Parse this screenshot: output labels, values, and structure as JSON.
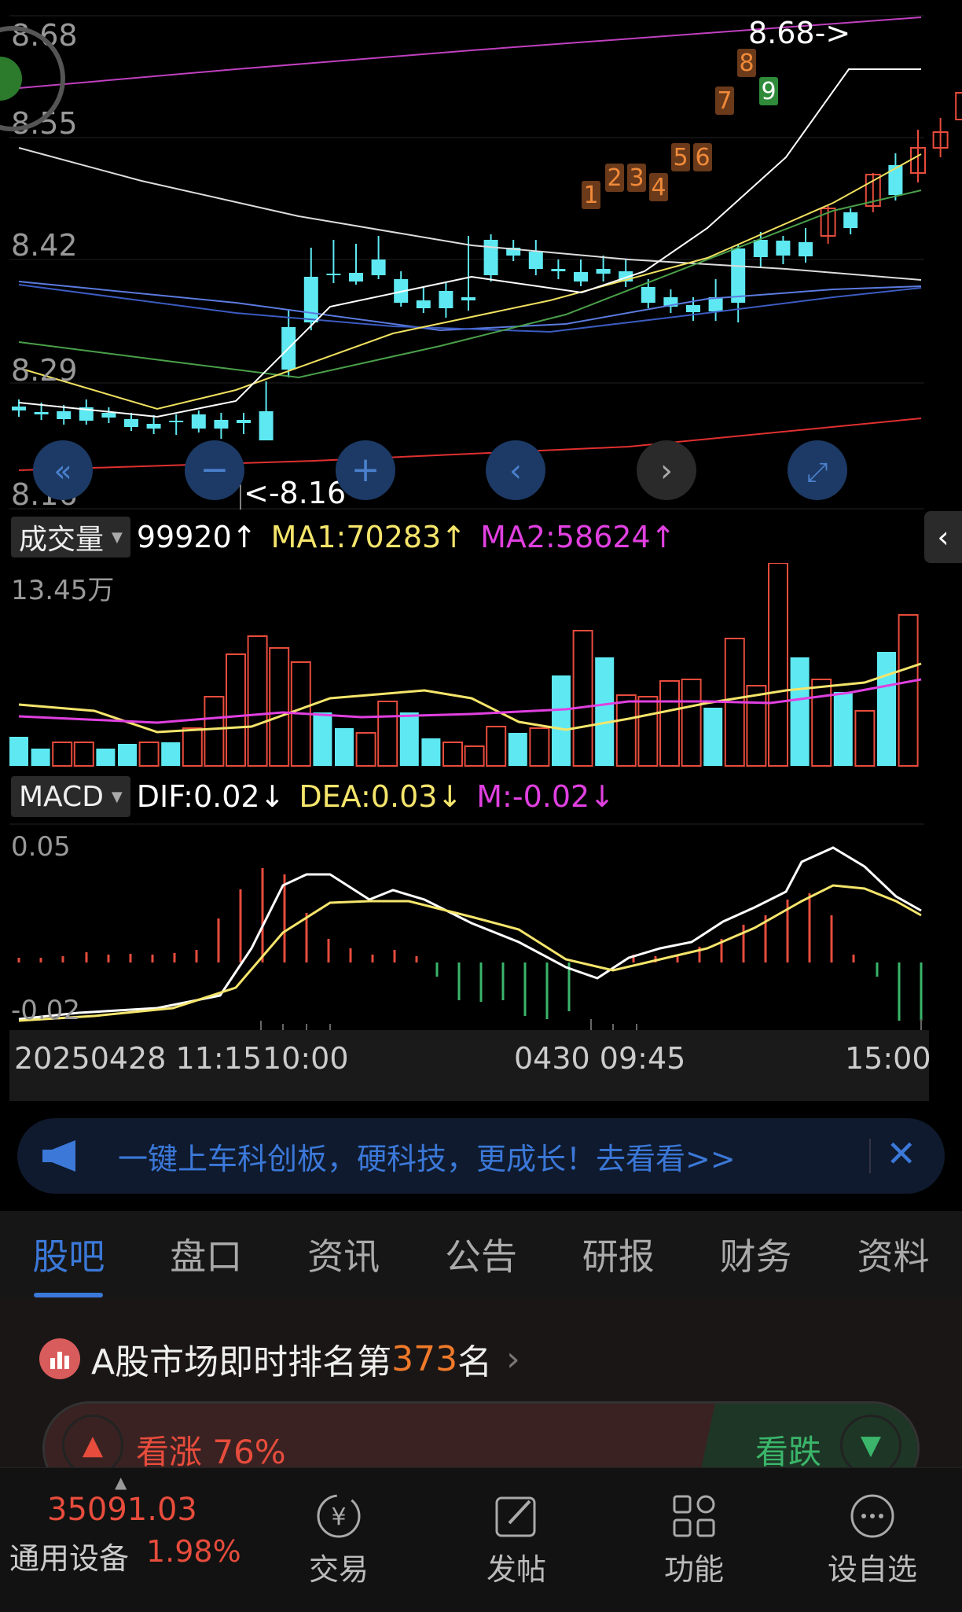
{
  "price_chart": {
    "y_labels": [
      "8.68",
      "8.55",
      "8.42",
      "8.29",
      "8.16"
    ],
    "high_marker": "8.68->",
    "low_marker": "<-8.16",
    "signal_labels": [
      "1",
      "2",
      "3",
      "4",
      "5",
      "6",
      "7",
      "8",
      "9"
    ]
  },
  "volume_panel": {
    "selector": "成交量",
    "value": "99920↑",
    "ma1": "MA1:70283↑",
    "ma2": "MA2:58624↑",
    "max_label": "13.45万"
  },
  "macd_panel": {
    "selector": "MACD",
    "dif": "DIF:0.02↓",
    "dea": "DEA:0.03↓",
    "m": "M:-0.02↓",
    "top_label": "0.05",
    "bottom_label": "-0.02"
  },
  "time_axis": {
    "t1": "20250428 11:15",
    "t2": "10:00",
    "t3": "0430 09:45",
    "t4": "15:00"
  },
  "ad_banner": {
    "text": "一键上车科创板，硬科技，更成长！去看看>>"
  },
  "tabs": [
    "股吧",
    "盘口",
    "资讯",
    "公告",
    "研报",
    "财务",
    "资料"
  ],
  "ranking": {
    "prefix": "A股市场即时排名第",
    "rank": "373",
    "suffix": "名",
    "bull_label": "看涨 76%",
    "bear_label": "看跌"
  },
  "bottom_bar": {
    "index_value": "35091.03",
    "sector_name": "通用设备",
    "sector_change": "1.98%",
    "trade": "交易",
    "post": "发帖",
    "functions": "功能",
    "watchlist": "设自选"
  },
  "colors": {
    "up": "#e74c3c",
    "down": "#5ee9f2",
    "accent": "#3b78d8",
    "ma_yellow": "#f5e56b",
    "ma_magenta": "#e040e0"
  }
}
